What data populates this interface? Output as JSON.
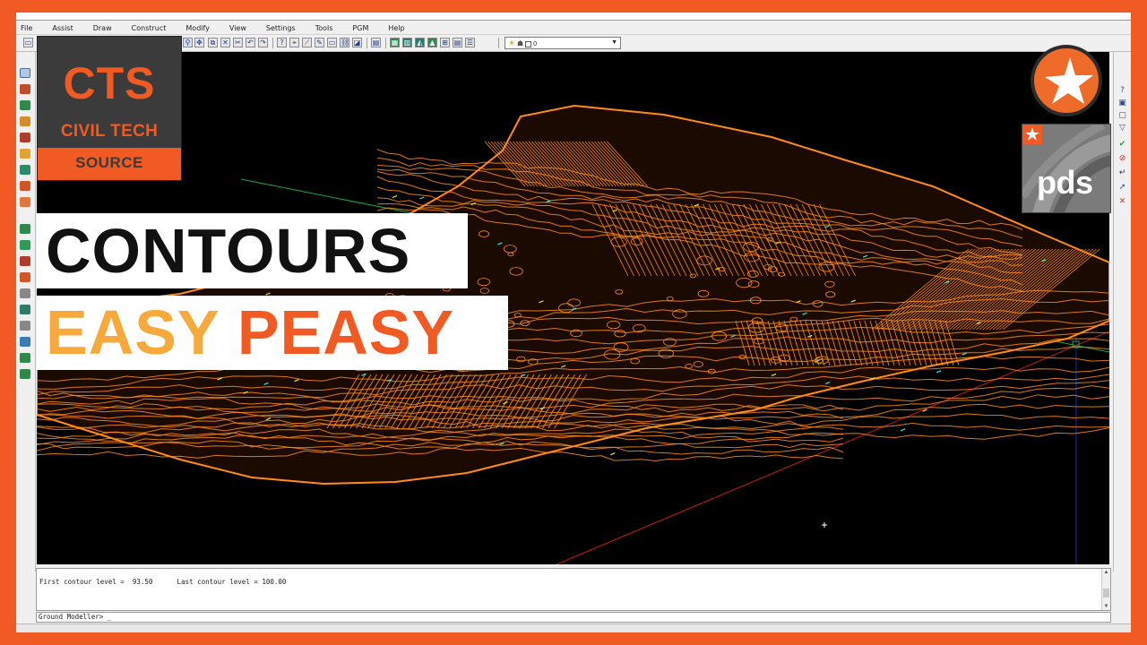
{
  "window": {
    "title": "",
    "menu": [
      "File",
      "Assist",
      "Draw",
      "Construct",
      "Modify",
      "View",
      "Settings",
      "Tools",
      "PGM",
      "Help"
    ]
  },
  "toolbar": {
    "layer_value": "0"
  },
  "command": {
    "history_line": "First contour level =  93.50      Last contour level = 100.00",
    "prompt": "Ground Modeller> _"
  },
  "overlay": {
    "logo_mark": "CTS",
    "logo_name": "CIVIL TECH",
    "logo_source": "SOURCE",
    "headline_1": "CONTOURS",
    "headline_2_word_1": "EASY",
    "headline_2_word_2": "PEASY",
    "badge_text": "pds"
  },
  "colors": {
    "brand_orange": "#f15a22",
    "accent_yellow": "#f7a93b",
    "contour_orange": "#ff8c1a",
    "viewport_bg": "#000000"
  },
  "icons": {
    "star_badge": "star-icon",
    "left_tools": "cad-tool-icons",
    "right_tools": "cad-snap-icons"
  }
}
